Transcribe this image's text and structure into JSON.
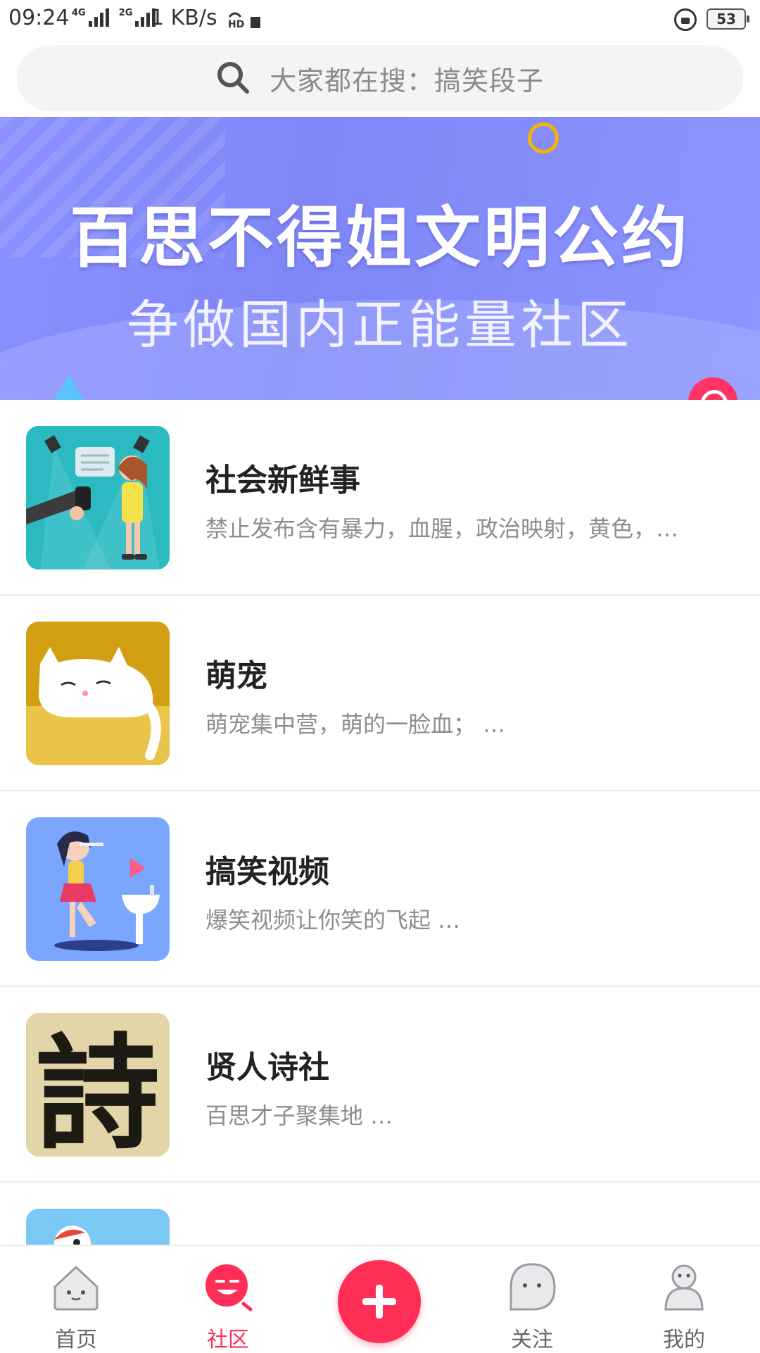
{
  "status_bar": {
    "time": "09:24",
    "network_1": "4G",
    "network_2": "2G",
    "speed": "1 KB/s",
    "hd": "HD",
    "battery": "53"
  },
  "search": {
    "placeholder": "大家都在搜：搞笑段子"
  },
  "banner": {
    "title": "百思不得姐文明公约",
    "subtitle": "争做国内正能量社区"
  },
  "communities": [
    {
      "name": "社会新鲜事",
      "desc": "禁止发布含有暴力，血腥，政治映射，黄色，…",
      "thumb_icon": "interview-reporter-icon"
    },
    {
      "name": "萌宠",
      "desc": "萌宠集中营，萌的一脸血； …",
      "thumb_icon": "sleeping-cat-icon"
    },
    {
      "name": "搞笑视频",
      "desc": "爆笑视频让你笑的飞起 …",
      "thumb_icon": "girl-brushing-teeth-icon"
    },
    {
      "name": "贤人诗社",
      "desc": "百思才子聚集地 …",
      "thumb_icon": "poem-calligraphy-icon",
      "thumb_text": "詩"
    }
  ],
  "bottom_nav": {
    "items": [
      {
        "label": "首页",
        "icon": "home-house-icon"
      },
      {
        "label": "社区",
        "icon": "community-face-icon",
        "active": true
      },
      {
        "label": "关注",
        "icon": "follow-face-icon"
      },
      {
        "label": "我的",
        "icon": "profile-person-icon"
      }
    ],
    "add_icon": "plus-icon"
  },
  "colors": {
    "accent": "#ff2e57",
    "banner_bg": "#8188f7",
    "text_primary": "#222222",
    "text_secondary": "#8d8d8d"
  }
}
